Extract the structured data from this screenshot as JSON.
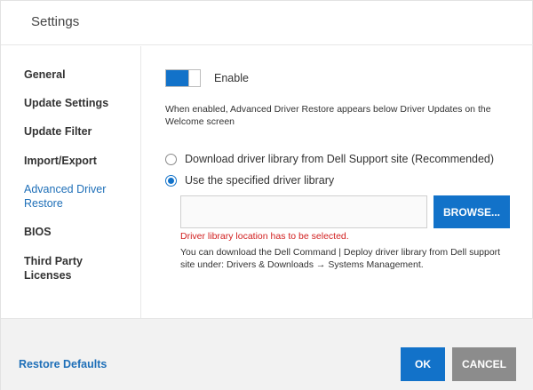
{
  "window": {
    "title": "Settings"
  },
  "sidebar": {
    "items": [
      {
        "label": "General"
      },
      {
        "label": "Update Settings"
      },
      {
        "label": "Update Filter"
      },
      {
        "label": "Import/Export"
      },
      {
        "label_line1": "Advanced Driver",
        "label_line2": "Restore",
        "active": true
      },
      {
        "label": "BIOS"
      },
      {
        "label_line1": "Third Party",
        "label_line2": "Licenses"
      }
    ]
  },
  "main": {
    "toggle": {
      "label": "Enable",
      "state": "on"
    },
    "description": "When enabled, Advanced Driver Restore appears below Driver Updates on the Welcome screen",
    "options": [
      {
        "label": "Download driver library from Dell Support site (Recommended)",
        "selected": false
      },
      {
        "label": "Use the specified driver library",
        "selected": true
      }
    ],
    "path_input": {
      "value": "",
      "placeholder": ""
    },
    "browse_label": "BROWSE...",
    "error_text": "Driver library location has to be selected.",
    "help_text": "You can download the Dell Command | Deploy driver library from Dell support site under: Drivers & Downloads → Systems Management."
  },
  "footer": {
    "restore_defaults": "Restore Defaults",
    "ok_label": "OK",
    "cancel_label": "CANCEL"
  },
  "colors": {
    "accent": "#1272c9",
    "link": "#1e6fb8",
    "error": "#d11f1f",
    "cancel_bg": "#8c8c8c",
    "footer_bg": "#f2f2f2"
  }
}
